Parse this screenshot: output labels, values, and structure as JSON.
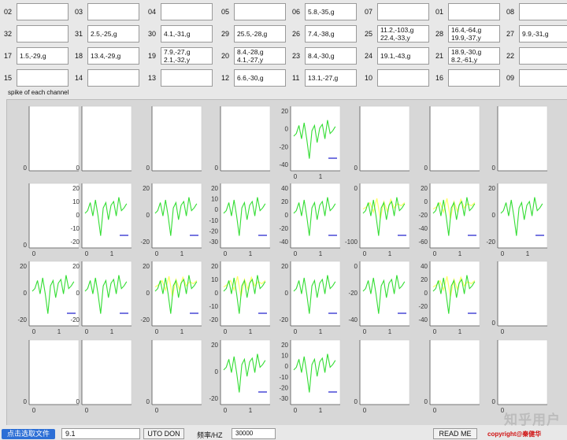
{
  "channels": [
    {
      "num": "02",
      "text": ""
    },
    {
      "num": "03",
      "text": ""
    },
    {
      "num": "04",
      "text": ""
    },
    {
      "num": "05",
      "text": ""
    },
    {
      "num": "06",
      "text": "5.8,-35,g"
    },
    {
      "num": "07",
      "text": ""
    },
    {
      "num": "01",
      "text": ""
    },
    {
      "num": "08",
      "text": ""
    },
    {
      "num": "32",
      "text": ""
    },
    {
      "num": "31",
      "text": "2.5,-25,g"
    },
    {
      "num": "30",
      "text": "4.1,-31,g"
    },
    {
      "num": "29",
      "text": "25.5,-28,g"
    },
    {
      "num": "26",
      "text": "7.4,-38,g"
    },
    {
      "num": "25",
      "text": "11.2,-103,g\n22.4,-33,y"
    },
    {
      "num": "28",
      "text": "16.4,-64,g\n19.9,-37,y"
    },
    {
      "num": "27",
      "text": "9.9,-31,g"
    },
    {
      "num": "17",
      "text": "1.5,-29,g"
    },
    {
      "num": "18",
      "text": "13.4,-29,g"
    },
    {
      "num": "19",
      "text": "7.9,-27,g\n2.1,-32,y"
    },
    {
      "num": "20",
      "text": "8.4,-28,g\n4.1,-27,y"
    },
    {
      "num": "23",
      "text": "8.4,-30,g"
    },
    {
      "num": "24",
      "text": "19.1,-43,g"
    },
    {
      "num": "21",
      "text": "18.9,-30,g\n8.2,-61,y"
    },
    {
      "num": "22",
      "text": ""
    },
    {
      "num": "15",
      "text": ""
    },
    {
      "num": "14",
      "text": ""
    },
    {
      "num": "13",
      "text": ""
    },
    {
      "num": "12",
      "text": "6.6,-30,g"
    },
    {
      "num": "11",
      "text": "13.1,-27,g"
    },
    {
      "num": "10",
      "text": ""
    },
    {
      "num": "16",
      "text": ""
    },
    {
      "num": "09",
      "text": ""
    }
  ],
  "spike_label": "spike of each channel",
  "plots": [
    {
      "yticks": [
        0
      ],
      "xticks": [],
      "waves": []
    },
    {
      "yticks": [
        0
      ],
      "xticks": [],
      "waves": []
    },
    {
      "yticks": [
        0
      ],
      "xticks": [],
      "waves": []
    },
    {
      "yticks": [
        0
      ],
      "xticks": [],
      "waves": []
    },
    {
      "yticks": [
        20,
        0,
        -20,
        -40
      ],
      "xticks": [
        0,
        1
      ],
      "waves": [
        "green"
      ]
    },
    {
      "yticks": [
        0
      ],
      "xticks": [],
      "waves": []
    },
    {
      "yticks": [
        0
      ],
      "xticks": [],
      "waves": []
    },
    {
      "yticks": [
        0
      ],
      "xticks": [],
      "waves": []
    },
    {
      "yticks": [
        0
      ],
      "xticks": [
        0
      ],
      "waves": []
    },
    {
      "yticks": [
        20,
        10,
        0,
        -10,
        -20
      ],
      "xticks": [
        0,
        1
      ],
      "waves": [
        "green"
      ]
    },
    {
      "yticks": [
        20,
        0,
        -20
      ],
      "xticks": [
        0,
        1
      ],
      "waves": [
        "green"
      ]
    },
    {
      "yticks": [
        20,
        10,
        0,
        -10,
        -20,
        -30
      ],
      "xticks": [
        0,
        1
      ],
      "waves": [
        "green"
      ]
    },
    {
      "yticks": [
        40,
        20,
        0,
        -20,
        -40
      ],
      "xticks": [
        0,
        1
      ],
      "waves": [
        "green"
      ]
    },
    {
      "yticks": [
        0,
        -100
      ],
      "xticks": [
        0,
        1
      ],
      "waves": [
        "green",
        "yellow"
      ]
    },
    {
      "yticks": [
        20,
        0,
        -20,
        -40,
        -60
      ],
      "xticks": [
        0,
        1
      ],
      "waves": [
        "green",
        "yellow"
      ]
    },
    {
      "yticks": [
        20,
        0,
        -20
      ],
      "xticks": [
        0,
        1
      ],
      "waves": [
        "green"
      ]
    },
    {
      "yticks": [
        20,
        0,
        -20
      ],
      "xticks": [
        0,
        1
      ],
      "waves": [
        "green"
      ]
    },
    {
      "yticks": [
        20,
        0,
        -20
      ],
      "xticks": [
        0,
        1
      ],
      "waves": [
        "green"
      ]
    },
    {
      "yticks": [
        20,
        0,
        -20
      ],
      "xticks": [
        0,
        1
      ],
      "waves": [
        "green",
        "yellow"
      ]
    },
    {
      "yticks": [
        20,
        10,
        0,
        -10,
        -20
      ],
      "xticks": [
        0,
        1
      ],
      "waves": [
        "green",
        "yellow"
      ]
    },
    {
      "yticks": [
        20,
        0,
        -20
      ],
      "xticks": [
        0,
        1
      ],
      "waves": [
        "green"
      ]
    },
    {
      "yticks": [
        0,
        -20,
        -40
      ],
      "xticks": [
        0,
        1
      ],
      "waves": [
        "green"
      ]
    },
    {
      "yticks": [
        40,
        20,
        0,
        -20,
        -40
      ],
      "xticks": [
        0,
        1
      ],
      "waves": [
        "green",
        "yellow"
      ]
    },
    {
      "yticks": [
        0
      ],
      "xticks": [
        0
      ],
      "waves": []
    },
    {
      "yticks": [
        0
      ],
      "xticks": [
        0
      ],
      "waves": []
    },
    {
      "yticks": [
        0
      ],
      "xticks": [
        0
      ],
      "waves": []
    },
    {
      "yticks": [
        0
      ],
      "xticks": [
        0
      ],
      "waves": []
    },
    {
      "yticks": [
        20,
        0,
        -20
      ],
      "xticks": [
        0,
        1
      ],
      "waves": [
        "green"
      ]
    },
    {
      "yticks": [
        20,
        10,
        0,
        -10,
        -20,
        -30
      ],
      "xticks": [
        0,
        1
      ],
      "waves": [
        "green"
      ]
    },
    {
      "yticks": [
        0
      ],
      "xticks": [
        0
      ],
      "waves": []
    },
    {
      "yticks": [
        0
      ],
      "xticks": [
        0
      ],
      "waves": []
    },
    {
      "yticks": [
        0
      ],
      "xticks": [
        0
      ],
      "waves": []
    }
  ],
  "bottom": {
    "open_button": "点击选取文件",
    "threshold_value": "9.1",
    "auto_button": "UTO DON",
    "freq_label": "频率/HZ",
    "freq_value": "30000",
    "readme_button": "READ ME",
    "copyright": "copyright@秦健华"
  },
  "watermark": "知乎用户",
  "colors": {
    "green": "#33dd33",
    "yellow": "#ffff66",
    "blue": "#1a1acc"
  }
}
